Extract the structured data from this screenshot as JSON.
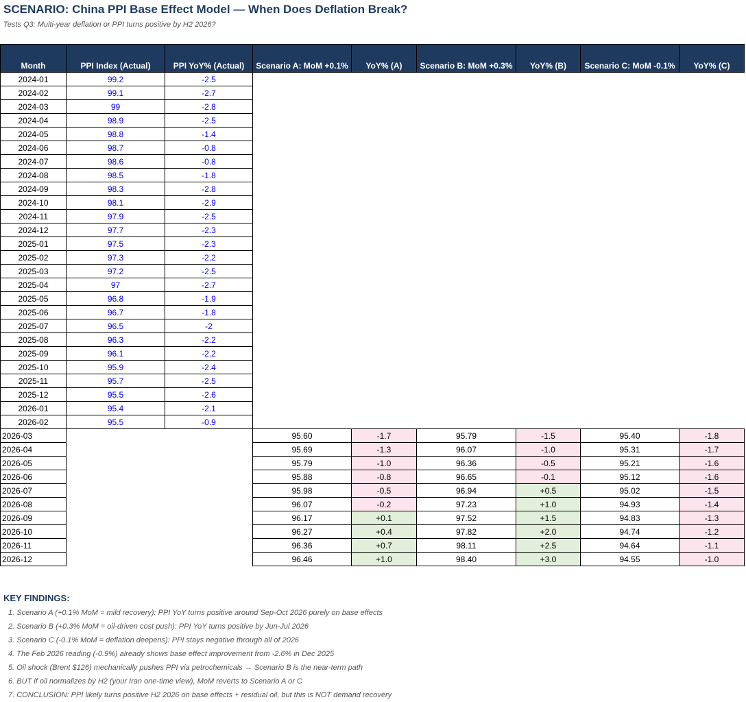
{
  "title": "SCENARIO: China PPI Base Effect Model — When Does Deflation Break?",
  "subtitle": "Tests Q3: Multi-year deflation or PPI turns positive by H2 2026?",
  "headers": [
    "Month",
    "PPI Index (Actual)",
    "PPI YoY% (Actual)",
    "Scenario A: MoM +0.1%",
    "YoY% (A)",
    "Scenario B: MoM +0.3%",
    "YoY% (B)",
    "Scenario C: MoM -0.1%",
    "YoY% (C)"
  ],
  "actual_rows": [
    [
      "2024-01",
      "99.2",
      "-2.5"
    ],
    [
      "2024-02",
      "99.1",
      "-2.7"
    ],
    [
      "2024-03",
      "99",
      "-2.8"
    ],
    [
      "2024-04",
      "98.9",
      "-2.5"
    ],
    [
      "2024-05",
      "98.8",
      "-1.4"
    ],
    [
      "2024-06",
      "98.7",
      "-0.8"
    ],
    [
      "2024-07",
      "98.6",
      "-0.8"
    ],
    [
      "2024-08",
      "98.5",
      "-1.8"
    ],
    [
      "2024-09",
      "98.3",
      "-2.8"
    ],
    [
      "2024-10",
      "98.1",
      "-2.9"
    ],
    [
      "2024-11",
      "97.9",
      "-2.5"
    ],
    [
      "2024-12",
      "97.7",
      "-2.3"
    ],
    [
      "2025-01",
      "97.5",
      "-2.3"
    ],
    [
      "2025-02",
      "97.3",
      "-2.2"
    ],
    [
      "2025-03",
      "97.2",
      "-2.5"
    ],
    [
      "2025-04",
      "97",
      "-2.7"
    ],
    [
      "2025-05",
      "96.8",
      "-1.9"
    ],
    [
      "2025-06",
      "96.7",
      "-1.8"
    ],
    [
      "2025-07",
      "96.5",
      "-2"
    ],
    [
      "2025-08",
      "96.3",
      "-2.2"
    ],
    [
      "2025-09",
      "96.1",
      "-2.2"
    ],
    [
      "2025-10",
      "95.9",
      "-2.4"
    ],
    [
      "2025-11",
      "95.7",
      "-2.5"
    ],
    [
      "2025-12",
      "95.5",
      "-2.6"
    ],
    [
      "2026-01",
      "95.4",
      "-2.1"
    ],
    [
      "2026-02",
      "95.5",
      "-0.9"
    ]
  ],
  "scenario_rows": [
    [
      "2026-03",
      "95.60",
      "-1.7",
      "95.79",
      "-1.5",
      "95.40",
      "-1.8"
    ],
    [
      "2026-04",
      "95.69",
      "-1.3",
      "96.07",
      "-1.0",
      "95.31",
      "-1.7"
    ],
    [
      "2026-05",
      "95.79",
      "-1.0",
      "96.36",
      "-0.5",
      "95.21",
      "-1.6"
    ],
    [
      "2026-06",
      "95.88",
      "-0.8",
      "96.65",
      "-0.1",
      "95.12",
      "-1.6"
    ],
    [
      "2026-07",
      "95.98",
      "-0.5",
      "96.94",
      "+0.5",
      "95.02",
      "-1.5"
    ],
    [
      "2026-08",
      "96.07",
      "-0.2",
      "97.23",
      "+1.0",
      "94.93",
      "-1.4"
    ],
    [
      "2026-09",
      "96.17",
      "+0.1",
      "97.52",
      "+1.5",
      "94.83",
      "-1.3"
    ],
    [
      "2026-10",
      "96.27",
      "+0.4",
      "97.82",
      "+2.0",
      "94.74",
      "-1.2"
    ],
    [
      "2026-11",
      "96.36",
      "+0.7",
      "98.11",
      "+2.5",
      "94.64",
      "-1.1"
    ],
    [
      "2026-12",
      "96.46",
      "+1.0",
      "98.40",
      "+3.0",
      "94.55",
      "-1.0"
    ]
  ],
  "colors": {
    "header_bg": "#1F3A5F",
    "actual_text": "#0000EE",
    "negative_fill": "#FCE4EC",
    "positive_fill": "#E2EFDA"
  },
  "findings_title": "KEY FINDINGS:",
  "findings": [
    "1. Scenario A (+0.1% MoM = mild recovery): PPI YoY turns positive around Sep-Oct 2026 purely on base effects",
    "2. Scenario B (+0.3% MoM = oil-driven cost push): PPI YoY turns positive by Jun-Jul 2026",
    "3. Scenario C (-0.1% MoM = deflation deepens): PPI stays negative through all of 2026",
    "4. The Feb 2026 reading (-0.9%) already shows base effect improvement from -2.6% in Dec 2025",
    "5. Oil shock (Brent $126) mechanically pushes PPI via petrochemicals → Scenario B is the near-term path",
    "6. BUT if oil normalizes by H2 (your Iran one-time view), MoM reverts to Scenario A or C",
    "7. CONCLUSION: PPI likely turns positive H2 2026 on base effects + residual oil, but this is NOT demand recovery"
  ]
}
